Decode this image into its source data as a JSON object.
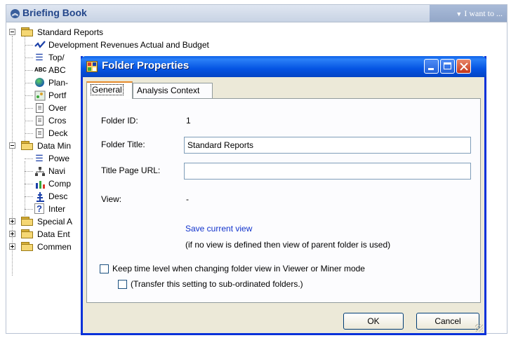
{
  "briefing_book": {
    "title": "Briefing Book",
    "i_want_to": "I want to ...",
    "tree": [
      {
        "label": "Standard Reports"
      },
      {
        "label": "Development Revenues Actual and Budget"
      },
      {
        "label": "Top/"
      },
      {
        "label": "ABC"
      },
      {
        "label": "Plan-"
      },
      {
        "label": "Portf"
      },
      {
        "label": "Over"
      },
      {
        "label": "Cros"
      },
      {
        "label": "Deck"
      },
      {
        "label": "Data Min"
      },
      {
        "label": "Powe"
      },
      {
        "label": "Navi"
      },
      {
        "label": "Comp"
      },
      {
        "label": "Desc"
      },
      {
        "label": "Inter"
      },
      {
        "label": "Special A"
      },
      {
        "label": "Data Ent"
      },
      {
        "label": "Commen"
      }
    ]
  },
  "dialog": {
    "title": "Folder Properties",
    "tabs": [
      "General",
      "Analysis Context"
    ],
    "folder_id_label": "Folder ID:",
    "folder_id_value": "1",
    "folder_title_label": "Folder Title:",
    "folder_title_value": "Standard Reports",
    "title_page_url_label": "Title Page URL:",
    "title_page_url_value": "",
    "view_label": "View:",
    "view_value": "-",
    "save_current_view": "Save current view",
    "view_note": "(if no view is defined then view of parent folder is used)",
    "keep_time_level": "Keep time level when changing folder view in Viewer or Miner mode",
    "transfer_setting": "(Transfer this setting to sub-ordinated folders.)",
    "ok_label": "OK",
    "cancel_label": "Cancel"
  },
  "colors": {
    "link": "#1133cc",
    "titlebar": "#0554e3",
    "header_text": "#23468a"
  }
}
